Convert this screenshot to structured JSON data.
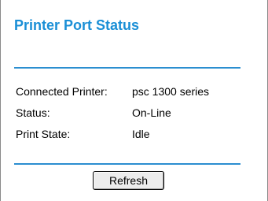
{
  "panel": {
    "title": "Printer Port Status"
  },
  "status": {
    "connected_printer_label": "Connected Printer:",
    "connected_printer_value": "psc 1300 series",
    "status_label": "Status:",
    "status_value": "On-Line",
    "print_state_label": "Print State:",
    "print_state_value": "Idle"
  },
  "actions": {
    "refresh_label": "Refresh"
  },
  "colors": {
    "title": "#1a8fd6",
    "rule": "#2b8ed0"
  }
}
